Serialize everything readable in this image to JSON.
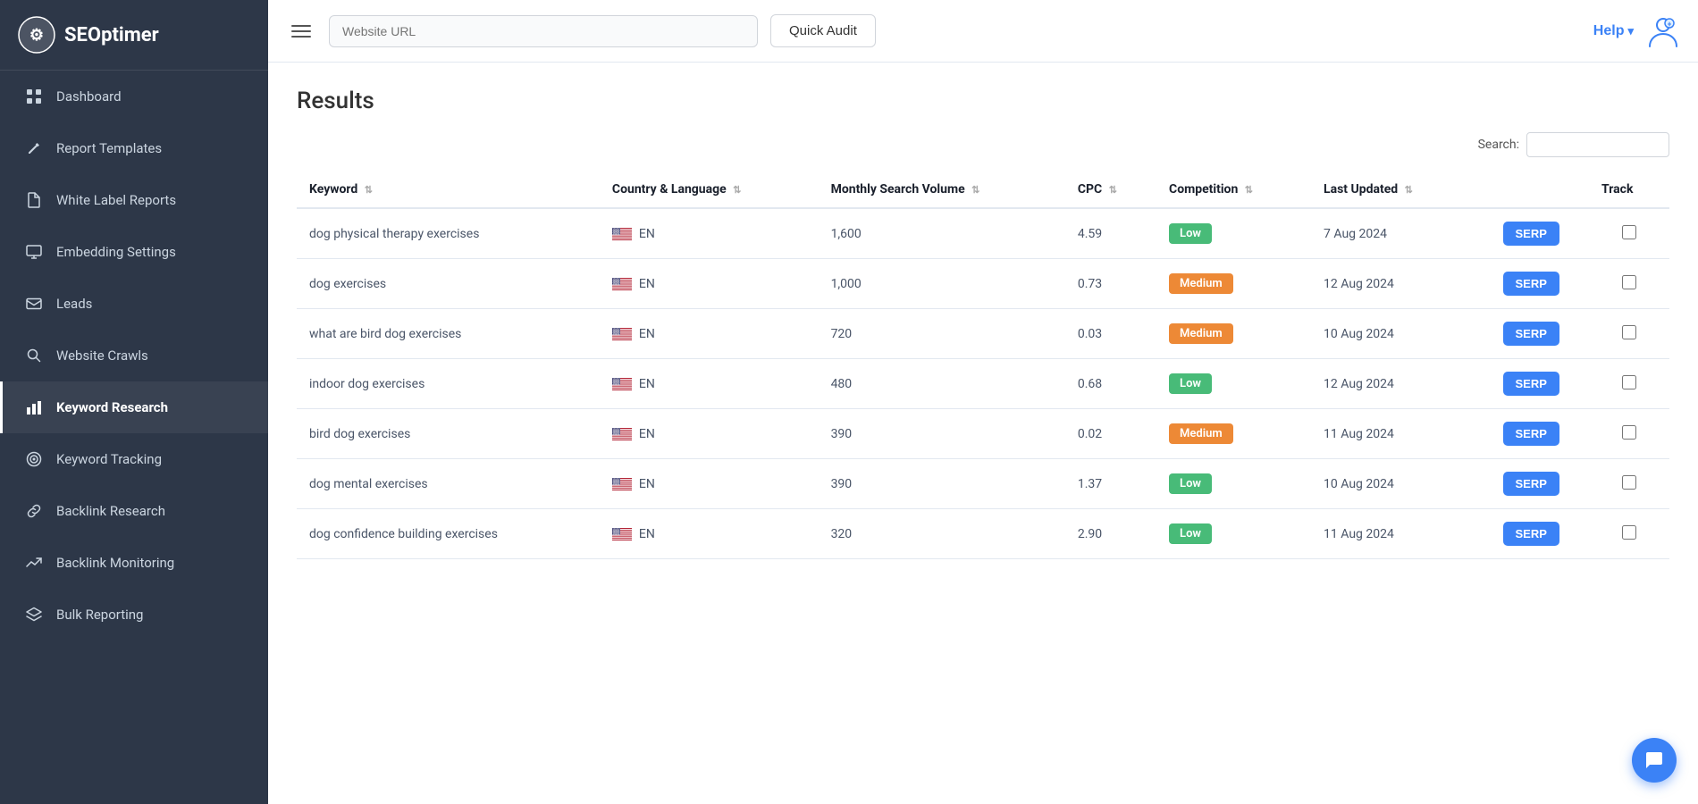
{
  "sidebar": {
    "logo_text": "SEOptimer",
    "items": [
      {
        "id": "dashboard",
        "label": "Dashboard",
        "icon": "grid",
        "active": false
      },
      {
        "id": "report-templates",
        "label": "Report Templates",
        "icon": "edit",
        "active": false
      },
      {
        "id": "white-label-reports",
        "label": "White Label Reports",
        "icon": "file",
        "active": false
      },
      {
        "id": "embedding-settings",
        "label": "Embedding Settings",
        "icon": "monitor",
        "active": false
      },
      {
        "id": "leads",
        "label": "Leads",
        "icon": "mail",
        "active": false
      },
      {
        "id": "website-crawls",
        "label": "Website Crawls",
        "icon": "search",
        "active": false
      },
      {
        "id": "keyword-research",
        "label": "Keyword Research",
        "icon": "bar-chart",
        "active": true
      },
      {
        "id": "keyword-tracking",
        "label": "Keyword Tracking",
        "icon": "target",
        "active": false
      },
      {
        "id": "backlink-research",
        "label": "Backlink Research",
        "icon": "link",
        "active": false
      },
      {
        "id": "backlink-monitoring",
        "label": "Backlink Monitoring",
        "icon": "trending-up",
        "active": false
      },
      {
        "id": "bulk-reporting",
        "label": "Bulk Reporting",
        "icon": "layers",
        "active": false
      }
    ]
  },
  "header": {
    "url_placeholder": "Website URL",
    "quick_audit_label": "Quick Audit",
    "help_label": "Help",
    "help_arrow": "▾"
  },
  "main": {
    "results_title": "Results",
    "search_label": "Search:",
    "search_placeholder": "",
    "table": {
      "columns": [
        {
          "id": "keyword",
          "label": "Keyword",
          "sortable": true
        },
        {
          "id": "country_language",
          "label": "Country & Language",
          "sortable": true
        },
        {
          "id": "monthly_search_volume",
          "label": "Monthly Search Volume",
          "sortable": true
        },
        {
          "id": "cpc",
          "label": "CPC",
          "sortable": true
        },
        {
          "id": "competition",
          "label": "Competition",
          "sortable": true
        },
        {
          "id": "last_updated",
          "label": "Last Updated",
          "sortable": true
        },
        {
          "id": "serp",
          "label": "",
          "sortable": false
        },
        {
          "id": "track",
          "label": "Track",
          "sortable": false
        }
      ],
      "rows": [
        {
          "keyword": "dog physical therapy exercises",
          "country": "EN",
          "volume": "1,600",
          "cpc": "4.59",
          "competition": "Low",
          "competition_type": "low",
          "last_updated": "7 Aug 2024"
        },
        {
          "keyword": "dog exercises",
          "country": "EN",
          "volume": "1,000",
          "cpc": "0.73",
          "competition": "Medium",
          "competition_type": "medium",
          "last_updated": "12 Aug 2024"
        },
        {
          "keyword": "what are bird dog exercises",
          "country": "EN",
          "volume": "720",
          "cpc": "0.03",
          "competition": "Medium",
          "competition_type": "medium",
          "last_updated": "10 Aug 2024"
        },
        {
          "keyword": "indoor dog exercises",
          "country": "EN",
          "volume": "480",
          "cpc": "0.68",
          "competition": "Low",
          "competition_type": "low",
          "last_updated": "12 Aug 2024"
        },
        {
          "keyword": "bird dog exercises",
          "country": "EN",
          "volume": "390",
          "cpc": "0.02",
          "competition": "Medium",
          "competition_type": "medium",
          "last_updated": "11 Aug 2024"
        },
        {
          "keyword": "dog mental exercises",
          "country": "EN",
          "volume": "390",
          "cpc": "1.37",
          "competition": "Low",
          "competition_type": "low",
          "last_updated": "10 Aug 2024"
        },
        {
          "keyword": "dog confidence building exercises",
          "country": "EN",
          "volume": "320",
          "cpc": "2.90",
          "competition": "Low",
          "competition_type": "low",
          "last_updated": "11 Aug 2024"
        }
      ],
      "serp_btn_label": "SERP"
    }
  },
  "colors": {
    "sidebar_bg": "#2d3748",
    "active_nav": "#ffffff",
    "badge_low": "#48bb78",
    "badge_medium": "#ed8936",
    "serp_btn": "#3b82f6"
  }
}
